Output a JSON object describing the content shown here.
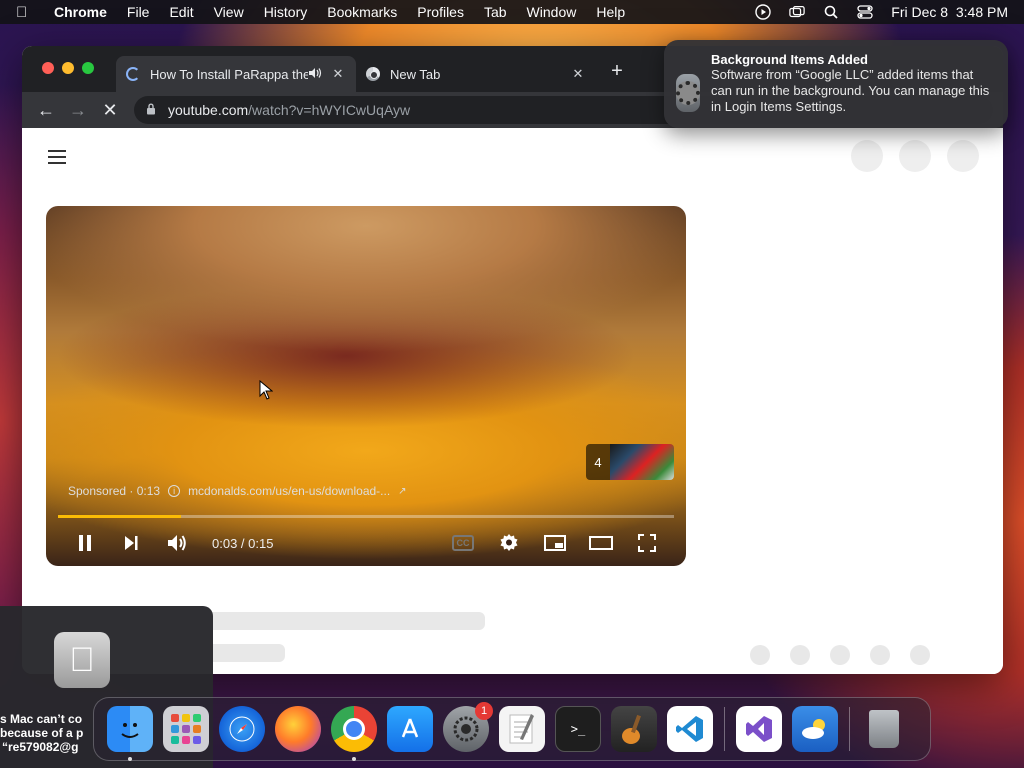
{
  "menubar": {
    "app_name": "Chrome",
    "menus": [
      "File",
      "Edit",
      "View",
      "History",
      "Bookmarks",
      "Profiles",
      "Tab",
      "Window",
      "Help"
    ],
    "datetime": "Fri Dec 8  3:48 PM"
  },
  "browser": {
    "tabs": [
      {
        "title": "How To Install PaRappa the",
        "state": "loading",
        "audio": true
      },
      {
        "title": "New Tab"
      }
    ],
    "address": {
      "host": "youtube.com",
      "path": "/watch?v=hWYICwUqAyw"
    }
  },
  "player": {
    "sponsored_label": "Sponsored · 0:13",
    "ad_url": "mcdonalds.com/us/en-us/download-...",
    "ad_count": "4",
    "time": "0:03 / 0:15",
    "progress": 0.2,
    "cc_label": "CC",
    "colors": {
      "progress": "#fbbc05"
    }
  },
  "notification": {
    "title": "Background Items Added",
    "body": "Software from “Google LLC” added items that can run in the background. You can manage this in Login Items Settings."
  },
  "alert": {
    "lines": [
      "s Mac can’t co",
      "because of a p",
      "“re579082@g"
    ]
  },
  "dock": {
    "settings_badge": "1",
    "terminal_prompt": ">_"
  }
}
